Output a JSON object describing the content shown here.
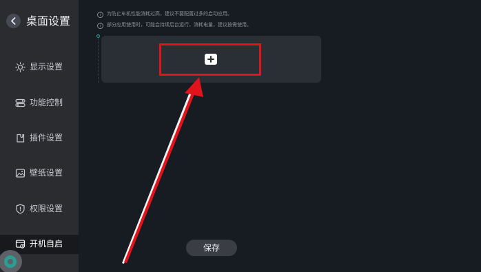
{
  "header": {
    "title": "桌面设置"
  },
  "sidebar": {
    "items": [
      {
        "label": "显示设置",
        "icon": "sun-icon"
      },
      {
        "label": "功能控制",
        "icon": "toggle-icon"
      },
      {
        "label": "插件设置",
        "icon": "plugin-icon"
      },
      {
        "label": "壁纸设置",
        "icon": "image-icon"
      },
      {
        "label": "权限设置",
        "icon": "shield-icon"
      },
      {
        "label": "开机自启",
        "icon": "startup-icon",
        "active": true
      }
    ]
  },
  "notices": [
    "为防止车机性能消耗过高，建议不要配置过多的启动应用。",
    "部分应用使用时，可能会持续后台运行，消耗电量，建议按需使用。"
  ],
  "actions": {
    "save_label": "保存"
  },
  "colors": {
    "accent": "#2a9e92",
    "annotation_red": "#e2131a",
    "background": "#171b22",
    "sidebar": "#2b2c2f",
    "panel": "#2a2e35"
  }
}
